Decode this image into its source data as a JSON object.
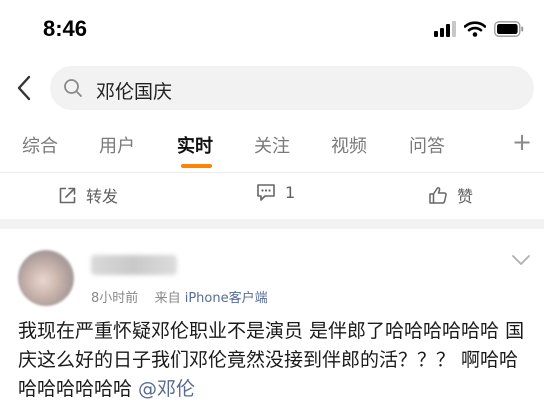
{
  "status_bar": {
    "time": "8:46",
    "icons": [
      "signal-icon",
      "wifi-icon",
      "battery-icon"
    ]
  },
  "search": {
    "query": "邓伦国庆"
  },
  "tabs": [
    {
      "label": "综合",
      "active": false
    },
    {
      "label": "用户",
      "active": false
    },
    {
      "label": "实时",
      "active": true
    },
    {
      "label": "关注",
      "active": false
    },
    {
      "label": "视频",
      "active": false
    },
    {
      "label": "问答",
      "active": false
    }
  ],
  "tab_plus": "+",
  "accent_color": "#ff8200",
  "actions": {
    "repost_label": "转发",
    "comment_count": "1",
    "like_label": "赞"
  },
  "post": {
    "time": "8小时前",
    "source_prefix": "来自",
    "source": "iPhone客户端",
    "text": "我现在严重怀疑邓伦职业不是演员 是伴郎了哈哈哈哈哈哈 国庆这么好的日子我们邓伦竟然没接到伴郎的活？？？ 啊哈哈哈哈哈哈哈哈 ",
    "mention": "@邓伦"
  }
}
